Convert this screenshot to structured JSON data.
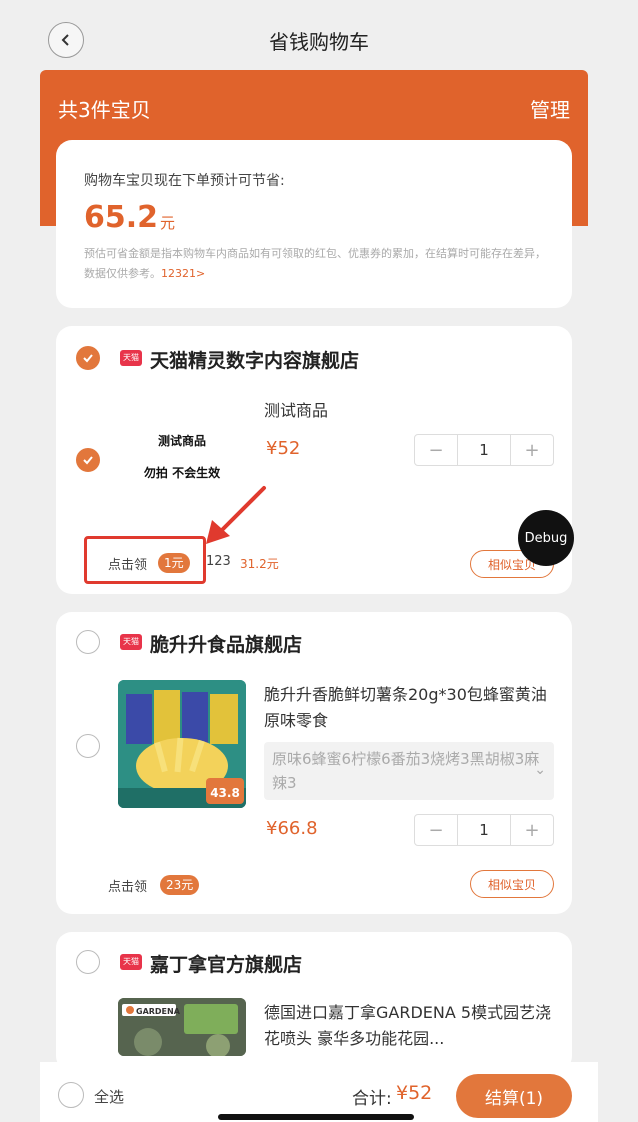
{
  "nav": {
    "title": "省钱购物车"
  },
  "banner": {
    "count_label": "共3件宝贝",
    "manage_label": "管理"
  },
  "savings": {
    "label": "购物车宝贝现在下单预计可节省:",
    "amount": "65.2",
    "unit": "元",
    "note": "预估可省金额是指本购物车内商品如有可领取的红包、优惠券的累加，在结算时可能存在差异，数据仅供参考。",
    "note_link": "12321>"
  },
  "shops": [
    {
      "tag": "天猫",
      "name": "天猫精灵数字内容旗舰店",
      "product": {
        "image_text_1": "测试商品",
        "image_text_2": "勿拍 不会生效",
        "title": "测试商品",
        "price": "¥52",
        "qty": "1"
      },
      "coupon_label": "点击领",
      "coupon_amount": "1元",
      "extra_text": "123",
      "extra_amount": "31.2元",
      "similar_label": "相似宝贝"
    },
    {
      "tag": "天猫",
      "name": "脆升升食品旗舰店",
      "product": {
        "title": "脆升升香脆鲜切薯条20g*30包蜂蜜黄油原味零食",
        "sku": "原味6蜂蜜6柠檬6番茄3烧烤3黑胡椒3麻辣3",
        "price": "¥66.8",
        "qty": "1",
        "image_price": "43.8"
      },
      "coupon_label": "点击领",
      "coupon_amount": "23元",
      "similar_label": "相似宝贝"
    },
    {
      "tag": "天猫",
      "name": "嘉丁拿官方旗舰店",
      "product": {
        "title": "德国进口嘉丁拿GARDENA 5模式园艺浇花喷头 豪华多功能花园...",
        "image_brand": "GARDENA"
      }
    }
  ],
  "debug_label": "Debug",
  "bottom": {
    "select_all": "全选",
    "total_label": "合计:",
    "total_value": "¥52",
    "checkout_label": "结算(1)"
  },
  "colors": {
    "accent": "#e0632c",
    "check": "#e2773c",
    "annotation": "#e03a2e"
  }
}
